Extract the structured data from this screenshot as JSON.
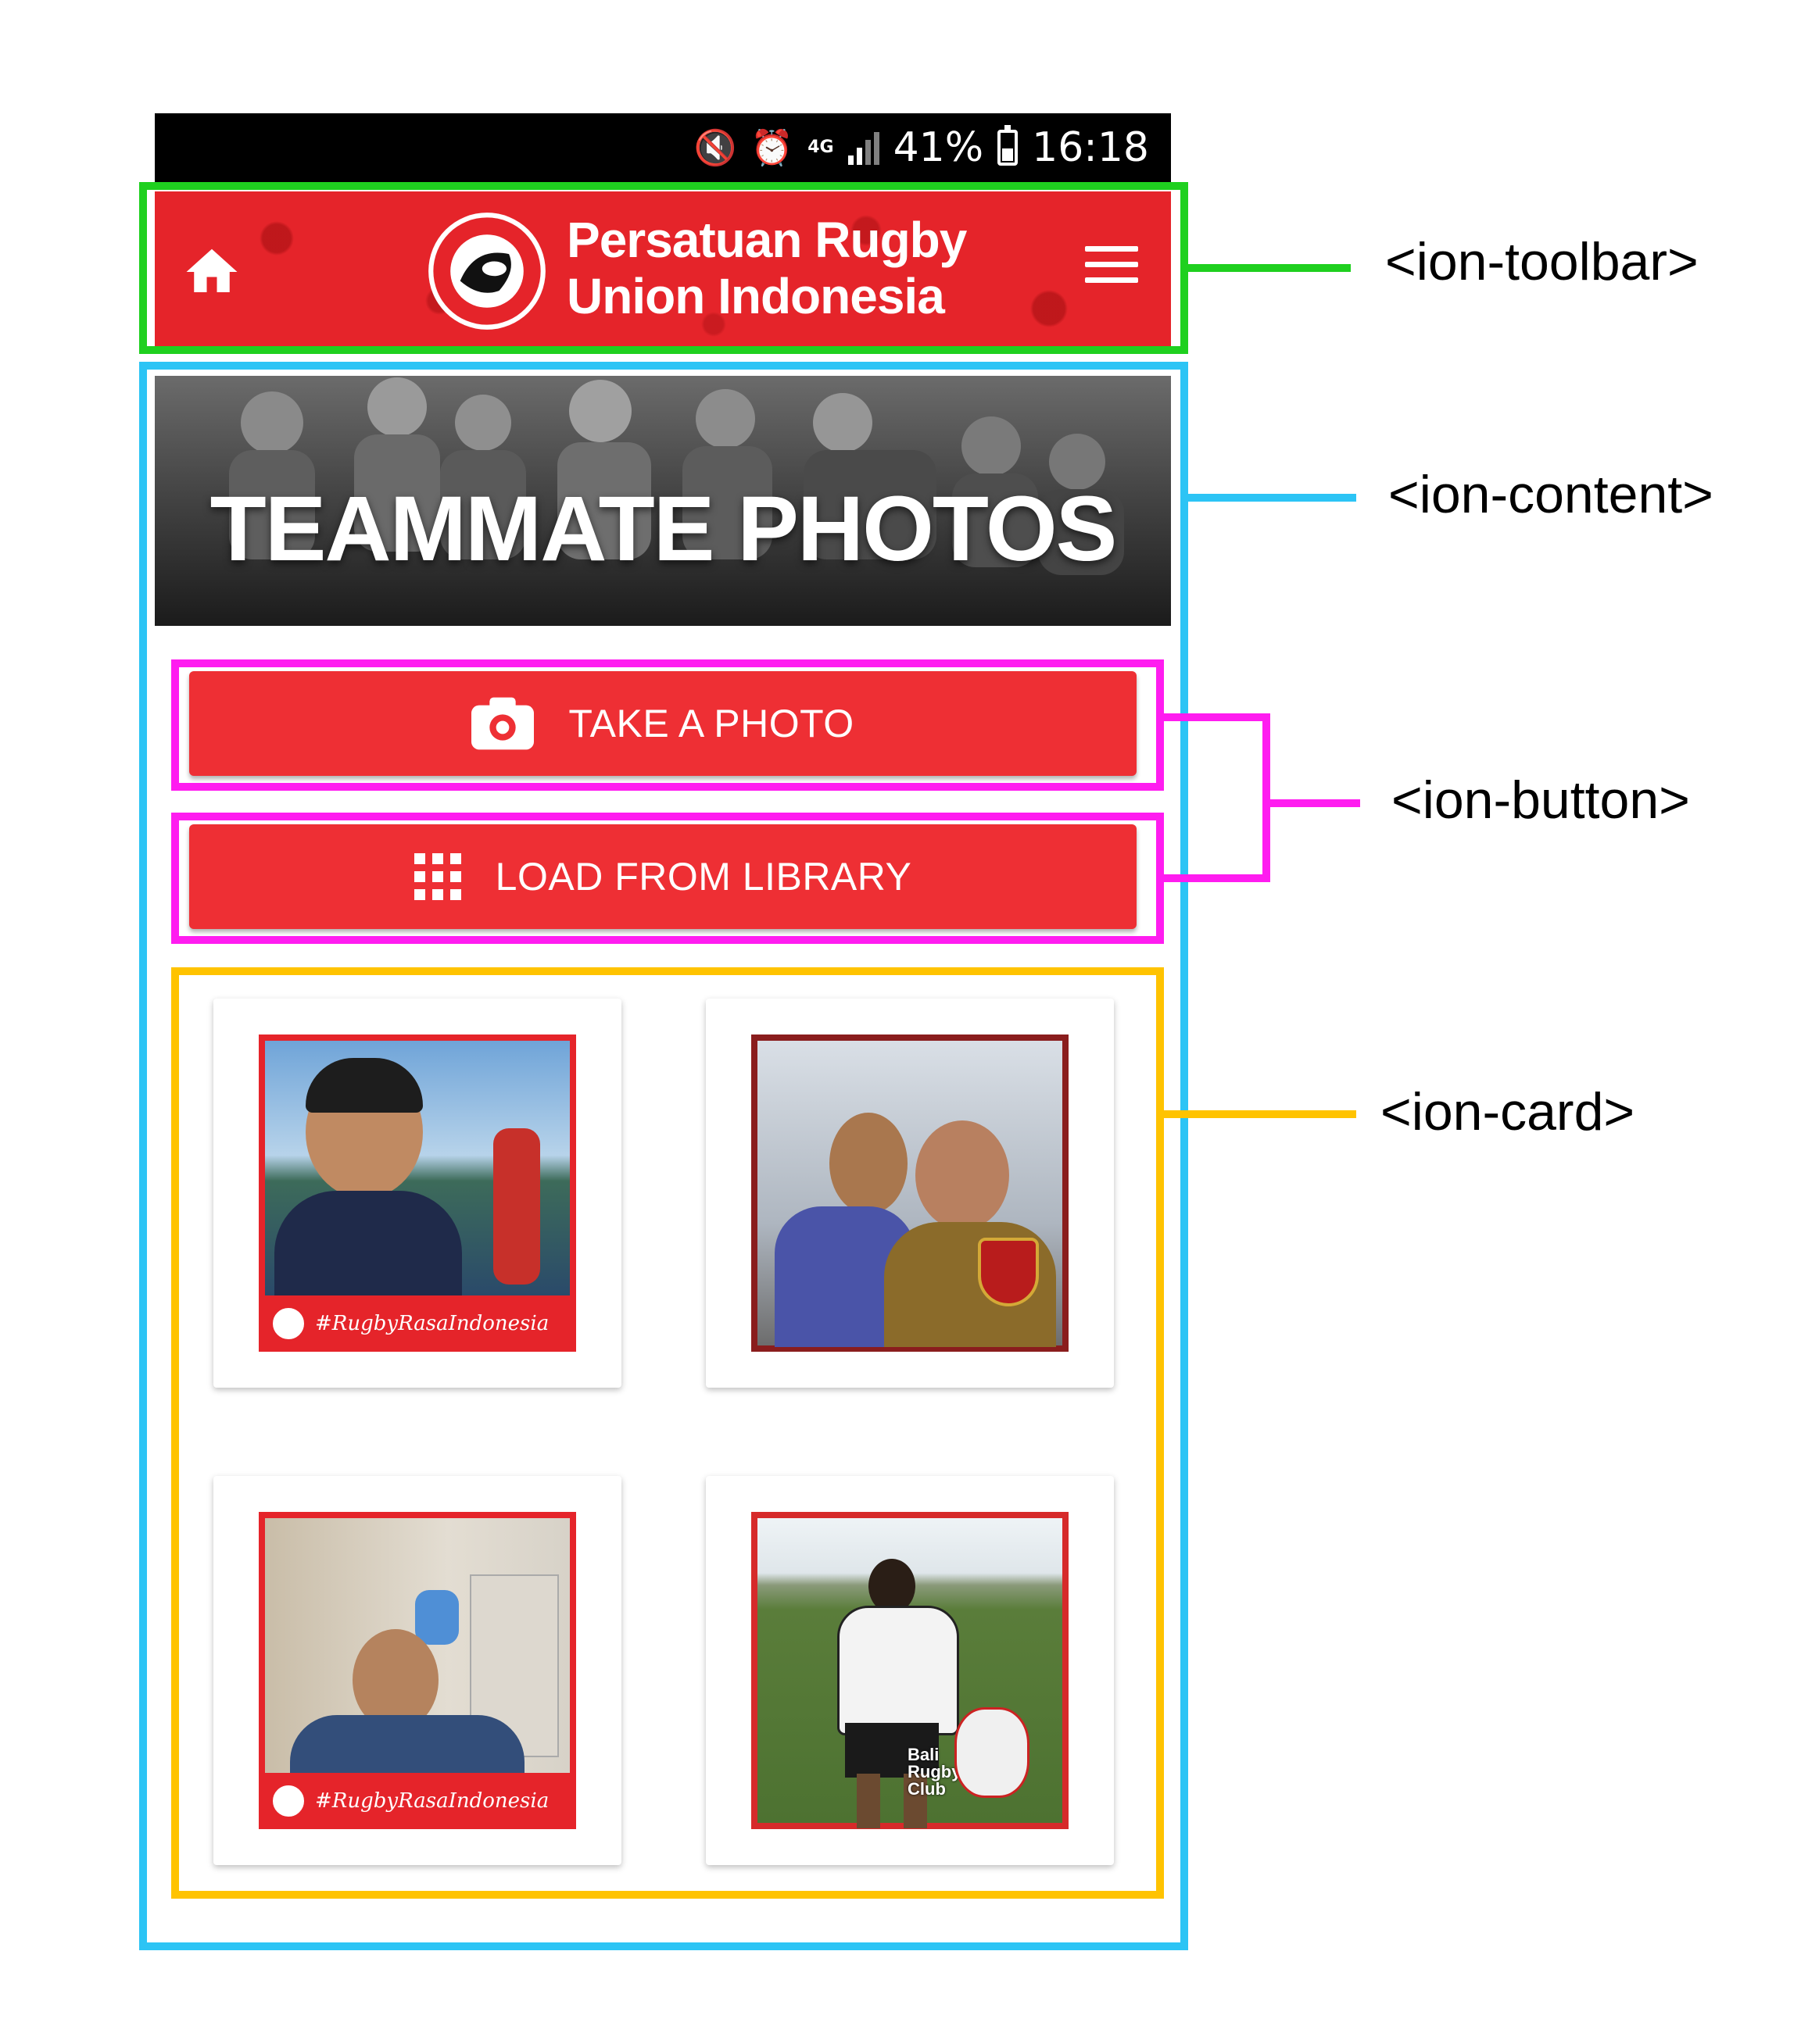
{
  "status_bar": {
    "network": "4G",
    "battery": "41%",
    "time": "16:18"
  },
  "toolbar": {
    "brand_line1": "Persatuan Rugby",
    "brand_line2": "Union Indonesia"
  },
  "hero": {
    "title": "TEAMMATE PHOTOS"
  },
  "buttons": {
    "take_photo": "TAKE A PHOTO",
    "load_library": "LOAD FROM LIBRARY"
  },
  "cards": {
    "tagline": "#RugbyRasaIndonesia",
    "card4_text": "Bali Rugby Club"
  },
  "annotations": {
    "toolbar": "<ion-toolbar>",
    "content": "<ion-content>",
    "button": "<ion-button>",
    "card": "<ion-card>"
  },
  "colors": {
    "brand_red": "#e5242a",
    "toolbar_annotation": "#1fd01f",
    "content_annotation": "#2cc4f5",
    "button_annotation": "#ff1cf0",
    "card_annotation": "#ffc300"
  }
}
